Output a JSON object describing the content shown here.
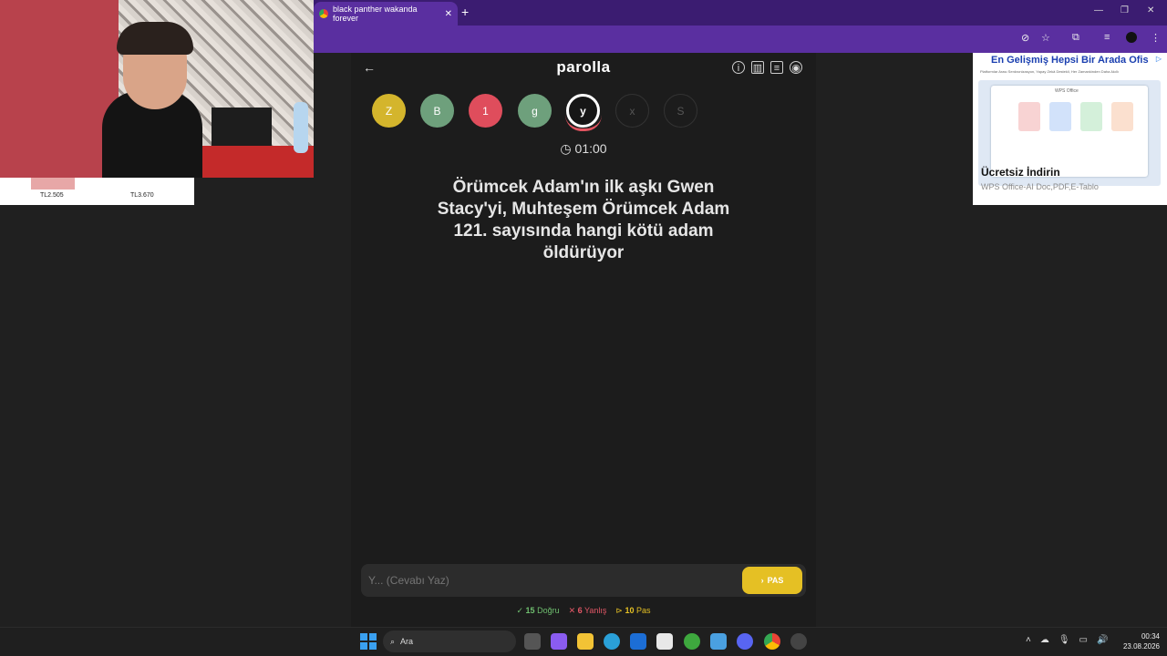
{
  "browser": {
    "tab_title": "black panther wakanda forever",
    "tab_close": "✕",
    "new_tab": "+",
    "window_controls": [
      "—",
      "❐",
      "✕"
    ]
  },
  "shop": {
    "price_1": "TL2.505",
    "price_2": "TL3.670"
  },
  "ad": {
    "headline": "En Gelişmiş Hepsi Bir Arada Ofis",
    "subtext": "Platformlar Arası Senkronizasyon, Yapay Zekâ Destekli, Her Zamankinden Daha Akıllı",
    "window_label": "WPS Office",
    "title": "Ücretsiz İndirin",
    "description": "WPS Office-AI Doc,PDF,E-Tablo"
  },
  "game": {
    "logo": "parolla",
    "letters": [
      {
        "char": "Z",
        "state": "correct",
        "color": "#d4b52c"
      },
      {
        "char": "B",
        "state": "correct",
        "color": "#6ea07c"
      },
      {
        "char": "1",
        "state": "wrong",
        "color": "#df4d5c"
      },
      {
        "char": "g",
        "state": "correct",
        "color": "#6ea07c"
      },
      {
        "char": "y",
        "state": "active",
        "color": "#161616"
      },
      {
        "char": "x",
        "state": "pending",
        "color": "transparent"
      },
      {
        "char": "S",
        "state": "pending",
        "color": "transparent"
      }
    ],
    "timer": "01:00",
    "question_lines": [
      "Örümcek Adam'ın ilk aşkı Gwen",
      "Stacy'yi, Muhteşem Örümcek Adam",
      "121. sayısında hangi kötü adam",
      "öldürüyor"
    ],
    "answer_placeholder": "Y... (Cevabı Yaz)",
    "pass_label": "PAS",
    "stats": {
      "correct_count": "15",
      "correct_label": "Doğru",
      "wrong_count": "6",
      "wrong_label": "Yanlış",
      "pass_count": "10",
      "pass_label": "Pas"
    }
  },
  "taskbar": {
    "search_label": "Ara",
    "time": "00:34",
    "date": "23.08.2026"
  }
}
